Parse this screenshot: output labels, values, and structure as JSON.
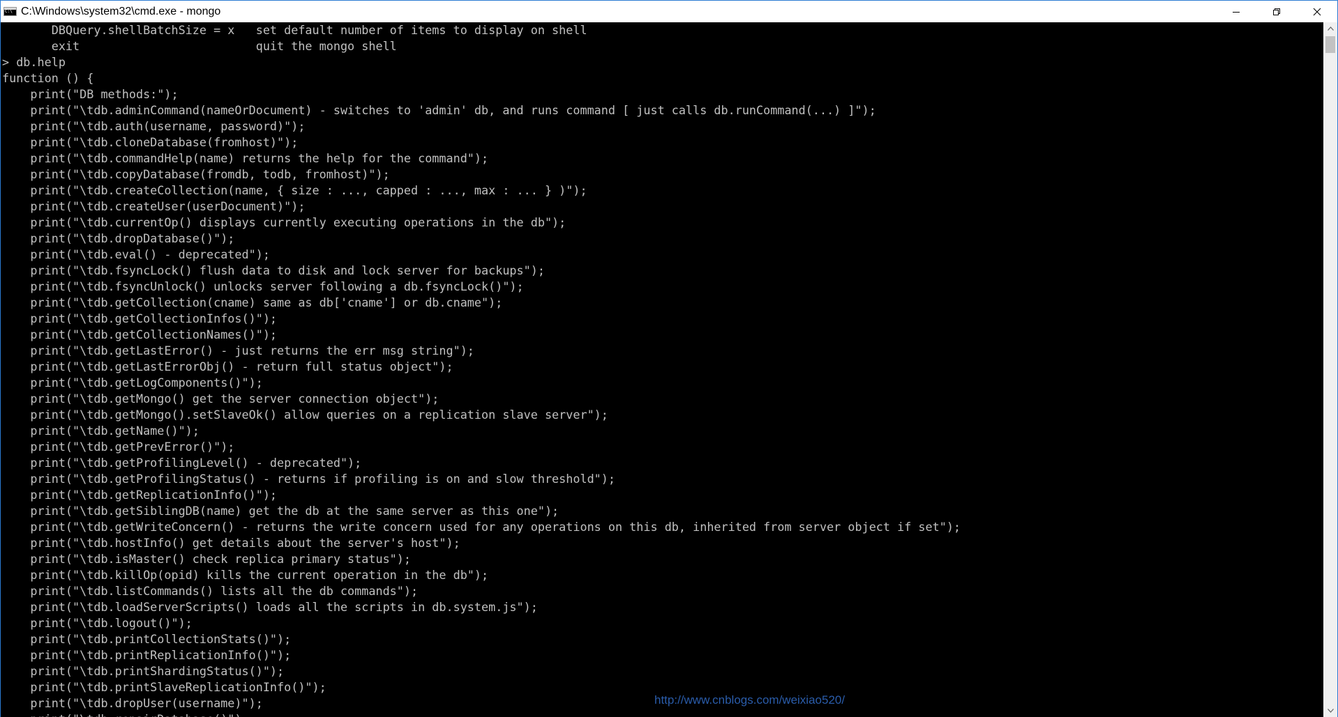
{
  "window": {
    "title": "C:\\Windows\\system32\\cmd.exe - mongo",
    "controls": [
      "minimize",
      "restore",
      "close"
    ]
  },
  "console": {
    "lines": [
      "       DBQuery.shellBatchSize = x   set default number of items to display on shell",
      "       exit                         quit the mongo shell",
      "> db.help",
      "function () {",
      "    print(\"DB methods:\");",
      "    print(\"\\tdb.adminCommand(nameOrDocument) - switches to 'admin' db, and runs command [ just calls db.runCommand(...) ]\");",
      "    print(\"\\tdb.auth(username, password)\");",
      "    print(\"\\tdb.cloneDatabase(fromhost)\");",
      "    print(\"\\tdb.commandHelp(name) returns the help for the command\");",
      "    print(\"\\tdb.copyDatabase(fromdb, todb, fromhost)\");",
      "    print(\"\\tdb.createCollection(name, { size : ..., capped : ..., max : ... } )\");",
      "    print(\"\\tdb.createUser(userDocument)\");",
      "    print(\"\\tdb.currentOp() displays currently executing operations in the db\");",
      "    print(\"\\tdb.dropDatabase()\");",
      "    print(\"\\tdb.eval() - deprecated\");",
      "    print(\"\\tdb.fsyncLock() flush data to disk and lock server for backups\");",
      "    print(\"\\tdb.fsyncUnlock() unlocks server following a db.fsyncLock()\");",
      "    print(\"\\tdb.getCollection(cname) same as db['cname'] or db.cname\");",
      "    print(\"\\tdb.getCollectionInfos()\");",
      "    print(\"\\tdb.getCollectionNames()\");",
      "    print(\"\\tdb.getLastError() - just returns the err msg string\");",
      "    print(\"\\tdb.getLastErrorObj() - return full status object\");",
      "    print(\"\\tdb.getLogComponents()\");",
      "    print(\"\\tdb.getMongo() get the server connection object\");",
      "    print(\"\\tdb.getMongo().setSlaveOk() allow queries on a replication slave server\");",
      "    print(\"\\tdb.getName()\");",
      "    print(\"\\tdb.getPrevError()\");",
      "    print(\"\\tdb.getProfilingLevel() - deprecated\");",
      "    print(\"\\tdb.getProfilingStatus() - returns if profiling is on and slow threshold\");",
      "    print(\"\\tdb.getReplicationInfo()\");",
      "    print(\"\\tdb.getSiblingDB(name) get the db at the same server as this one\");",
      "    print(\"\\tdb.getWriteConcern() - returns the write concern used for any operations on this db, inherited from server object if set\");",
      "    print(\"\\tdb.hostInfo() get details about the server's host\");",
      "    print(\"\\tdb.isMaster() check replica primary status\");",
      "    print(\"\\tdb.killOp(opid) kills the current operation in the db\");",
      "    print(\"\\tdb.listCommands() lists all the db commands\");",
      "    print(\"\\tdb.loadServerScripts() loads all the scripts in db.system.js\");",
      "    print(\"\\tdb.logout()\");",
      "    print(\"\\tdb.printCollectionStats()\");",
      "    print(\"\\tdb.printReplicationInfo()\");",
      "    print(\"\\tdb.printShardingStatus()\");",
      "    print(\"\\tdb.printSlaveReplicationInfo()\");",
      "    print(\"\\tdb.dropUser(username)\");",
      "    print(\"\\tdb.repairDatabase()\");"
    ],
    "text_color": "#c0c0c0",
    "background_color": "#000000"
  },
  "watermark": {
    "text": "http://www.cnblogs.com/weixiao520/"
  }
}
